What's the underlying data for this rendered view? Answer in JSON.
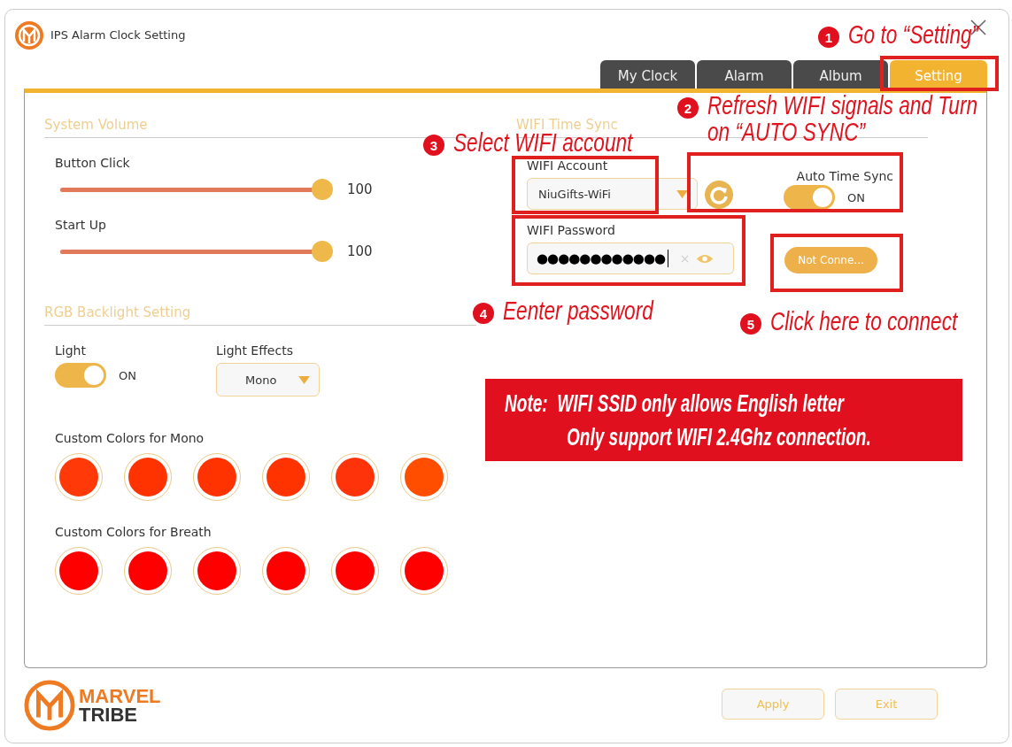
{
  "window": {
    "title": "IPS Alarm Clock Setting"
  },
  "tabs": [
    {
      "label": "My Clock",
      "selected": false
    },
    {
      "label": "Alarm",
      "selected": false
    },
    {
      "label": "Album",
      "selected": false
    },
    {
      "label": "Setting",
      "selected": true
    }
  ],
  "system_volume": {
    "title": "System Volume",
    "sliders": [
      {
        "label": "Button Click",
        "level": 1,
        "reading": "100"
      },
      {
        "label": "Start Up",
        "level": 1,
        "reading": "100"
      }
    ]
  },
  "rgb_backlight": {
    "title": "RGB Backlight Setting",
    "light": {
      "label": "Light",
      "on": true,
      "state": "ON"
    },
    "effects": {
      "label": "Light Effects",
      "value": "Mono"
    },
    "palettes": [
      {
        "label": "Custom Colors for Mono",
        "colors": [
          {
            "color": "#ff3a08"
          },
          {
            "color": "#ff3300"
          },
          {
            "color": "#ff3300"
          },
          {
            "color": "#ff3300"
          },
          {
            "color": "#ff330a"
          },
          {
            "color": "#ff4e00"
          }
        ]
      },
      {
        "label": "Custom Colors for Breath",
        "colors": [
          {
            "color": "#ff0000"
          },
          {
            "color": "#ff0000"
          },
          {
            "color": "#ff0000"
          },
          {
            "color": "#ff0000"
          },
          {
            "color": "#ff0000"
          },
          {
            "color": "#ff0000"
          }
        ]
      }
    ]
  },
  "wifi": {
    "title": "WIFI Time Sync",
    "account": {
      "label": "WIFI Account",
      "value": "NiuGifts-WiFi"
    },
    "auto_sync": {
      "label": "Auto Time Sync",
      "on": true,
      "state": "ON"
    },
    "password": {
      "label": "WIFI Password",
      "value": "●●●●●●●●●●●●"
    },
    "connect_button": "Not Conne..."
  },
  "footer": {
    "brand": [
      "MARVEL",
      "TRIBE"
    ],
    "buttons": [
      "Apply",
      "Exit"
    ]
  },
  "annotations": [
    {
      "number": "1",
      "text": "Go to “Setting”"
    },
    {
      "number": "2",
      "text": "Refresh WIFI signals and Turn",
      "text_2": "on “AUTO SYNC”"
    },
    {
      "number": "3",
      "text": "Select WIFI account"
    },
    {
      "number": "4",
      "text": "Eenter password"
    },
    {
      "number": "5",
      "text": "Click here to connect"
    }
  ],
  "note": [
    "Note:  WIFI SSID only allows English letter",
    "Only support WIFI 2.4Ghz connection."
  ]
}
